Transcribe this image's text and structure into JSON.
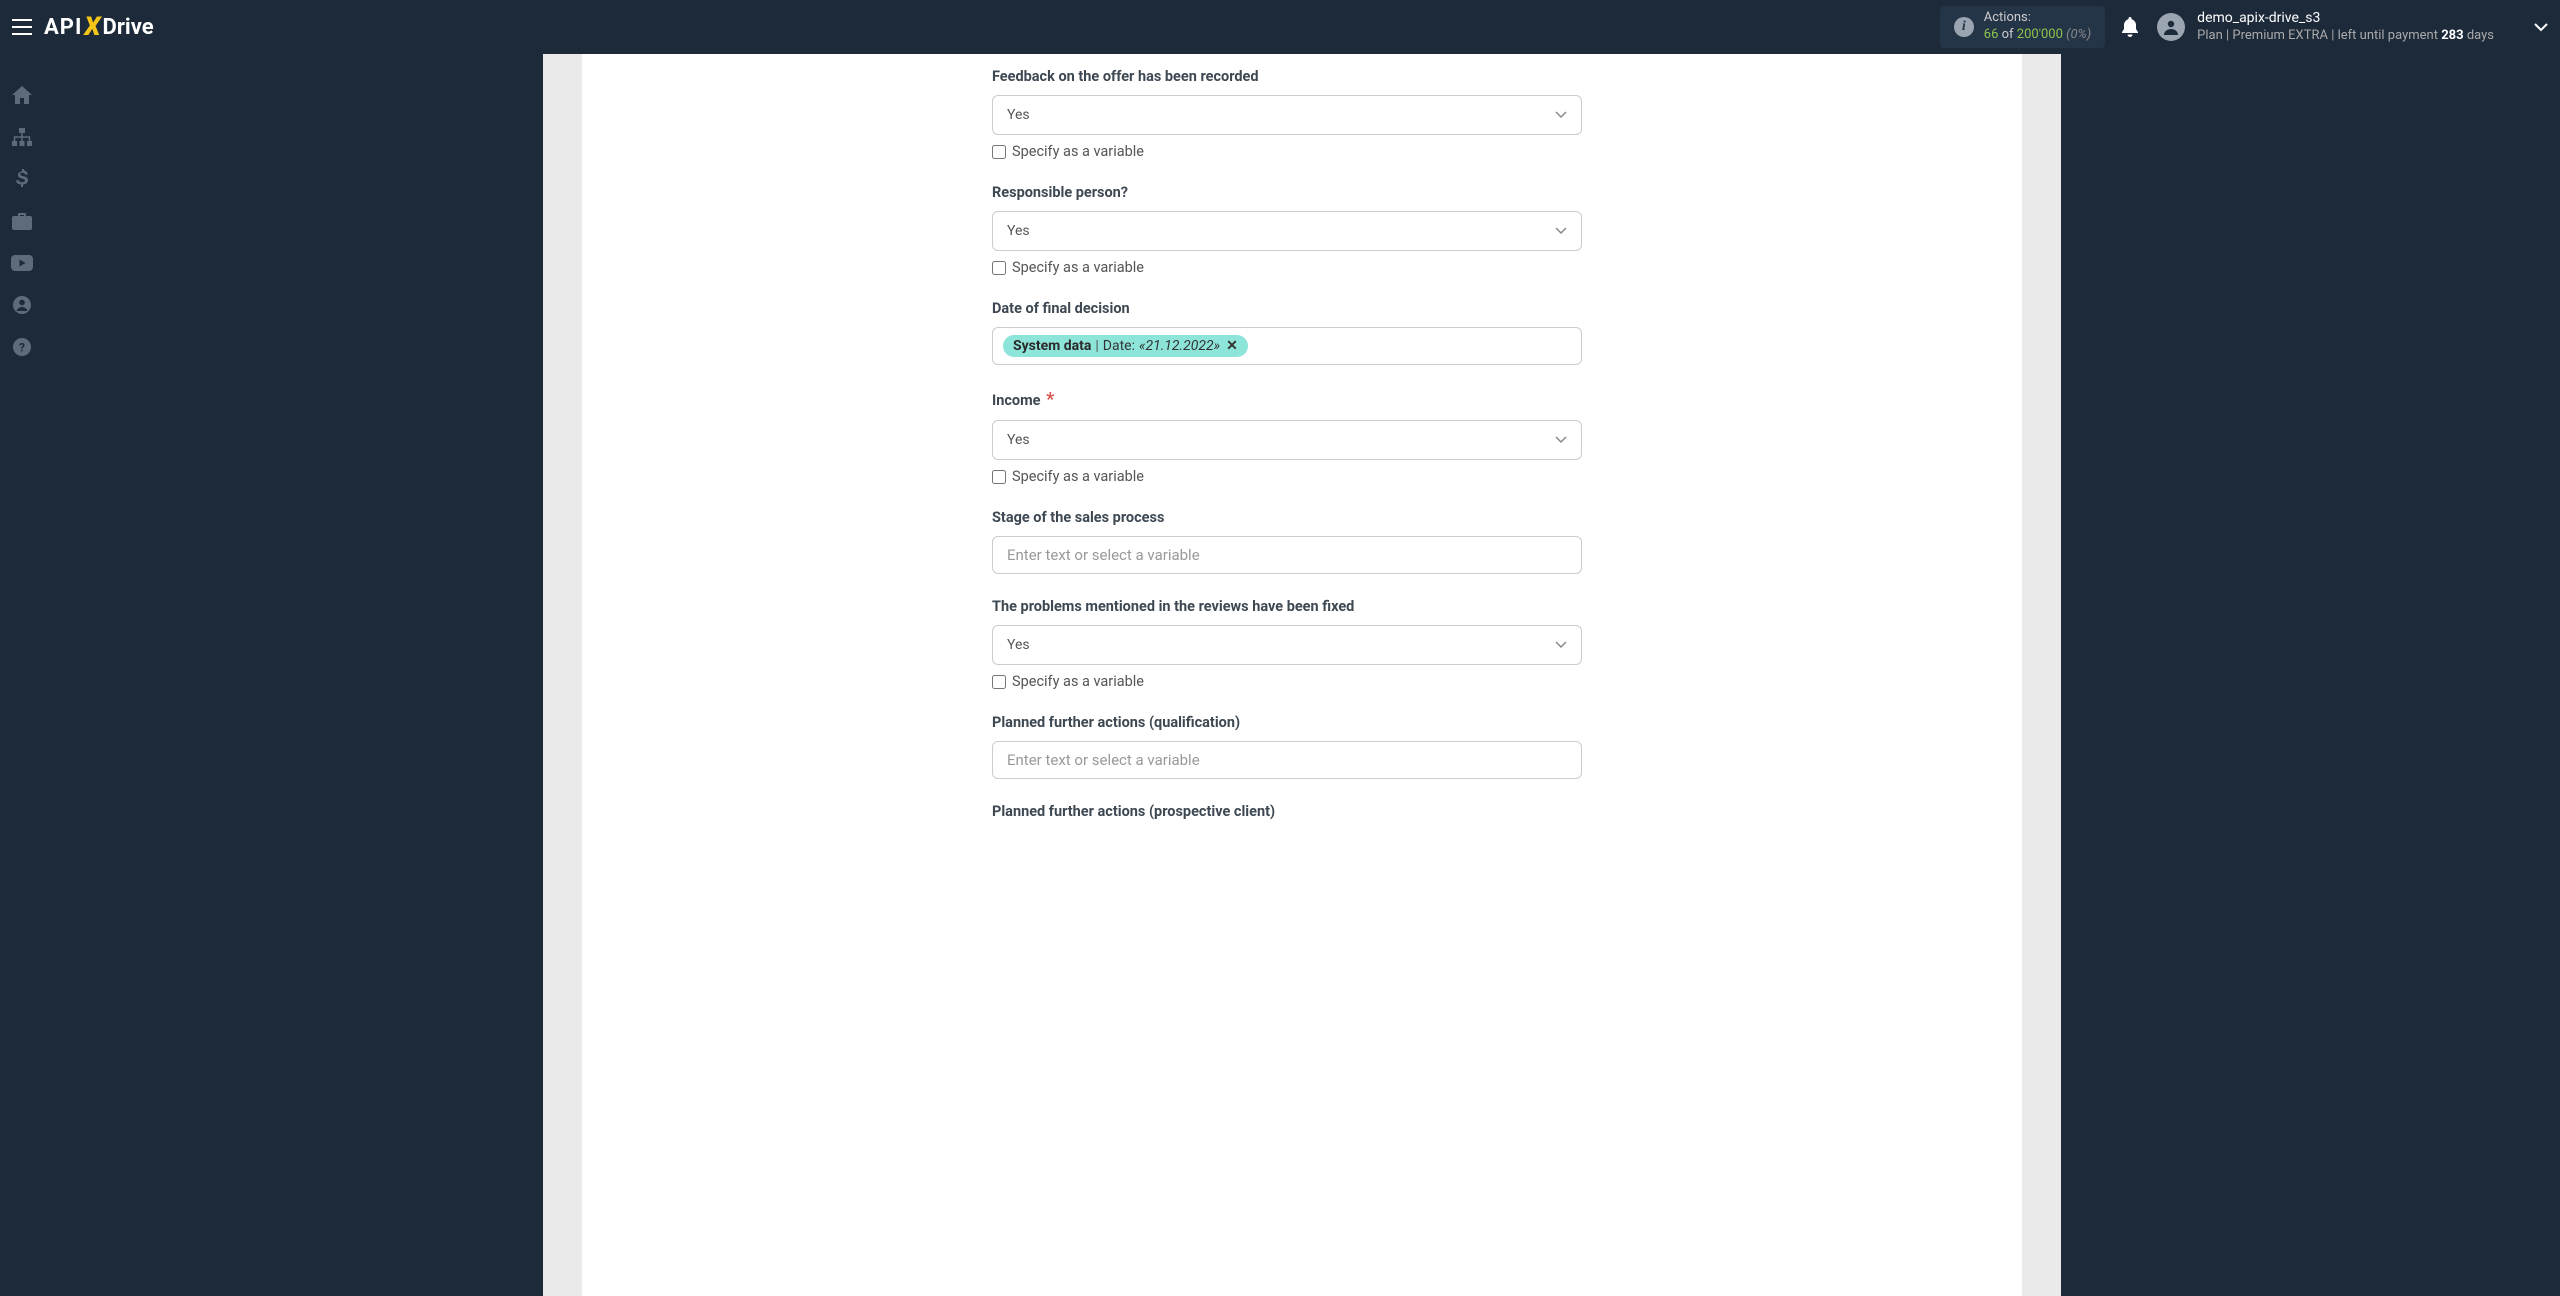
{
  "header": {
    "logo_api": "API",
    "logo_drive": "Drive",
    "actions_label": "Actions:",
    "actions_count": "66",
    "actions_of": "of",
    "actions_total": "200'000",
    "actions_pct": "(0%)",
    "user_name": "demo_apix-drive_s3",
    "plan_prefix": "Plan |",
    "plan_name": "Premium EXTRA",
    "plan_sep": "|",
    "plan_left": "left until payment",
    "plan_days_num": "283",
    "plan_days_suffix": "days"
  },
  "form": {
    "select_value_yes": "Yes",
    "specify_variable": "Specify as a variable",
    "text_placeholder": "Enter text or select a variable",
    "fields": {
      "feedback": {
        "label": "Feedback on the offer has been recorded"
      },
      "responsible": {
        "label": "Responsible person?"
      },
      "date_decision": {
        "label": "Date of final decision",
        "tag_key": "System data",
        "tag_label": "Date:",
        "tag_value": "«21.12.2022»"
      },
      "income": {
        "label": "Income"
      },
      "stage": {
        "label": "Stage of the sales process"
      },
      "problems_fixed": {
        "label": "The problems mentioned in the reviews have been fixed"
      },
      "planned_qualification": {
        "label": "Planned further actions (qualification)"
      },
      "planned_prospective": {
        "label": "Planned further actions (prospective client)"
      }
    }
  }
}
